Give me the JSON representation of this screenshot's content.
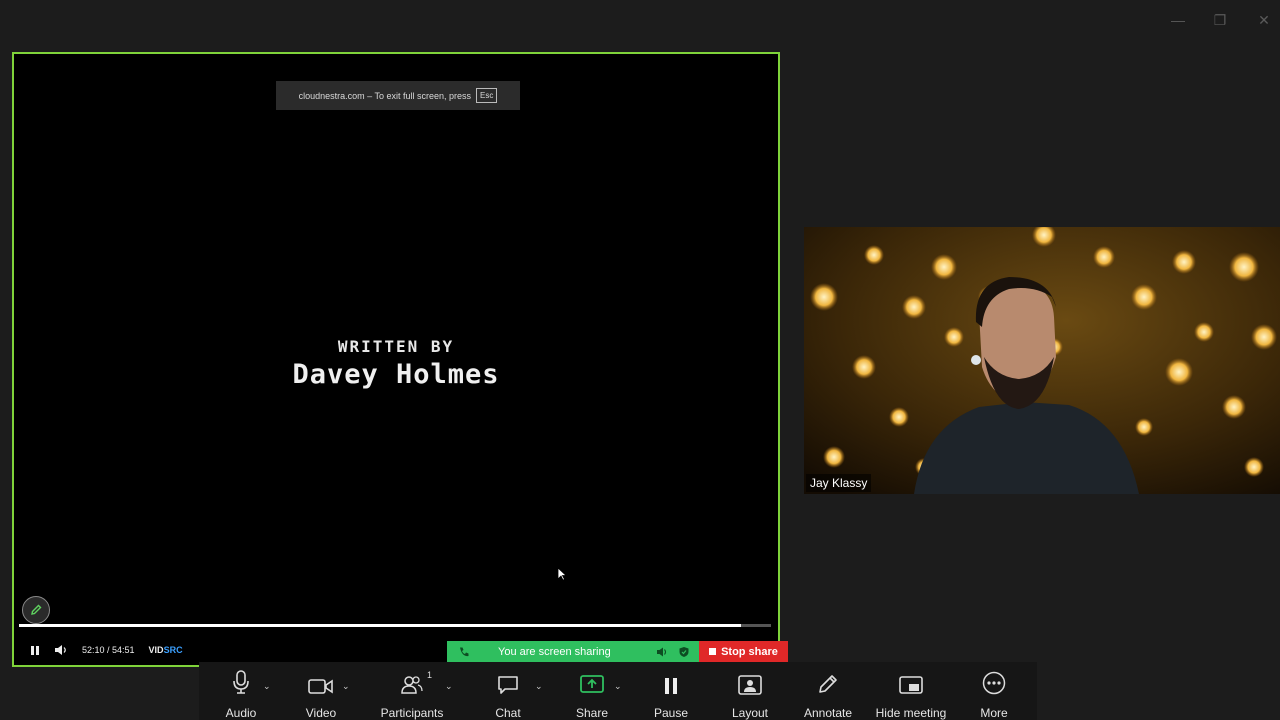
{
  "window": {
    "minimize_glyph": "—",
    "restore_glyph": "❐",
    "close_glyph": "✕"
  },
  "share": {
    "fullscreen_notice": "cloudnestra.com – To exit full screen, press",
    "esc_label": "Esc",
    "credit_title": "WRITTEN BY",
    "credit_name": "Davey Holmes",
    "time": "52:10 / 54:51",
    "brand_a": "VID",
    "brand_b": "SRC",
    "progress": 0.96
  },
  "sharing_bar": {
    "status": "You are screen sharing",
    "stop_label": "Stop share"
  },
  "participant": {
    "name": "Jay Klassy"
  },
  "toolbar": {
    "participants_count": "1",
    "items": [
      {
        "label": "Audio",
        "icon": "microphone-icon"
      },
      {
        "label": "Video",
        "icon": "video-camera-icon"
      },
      {
        "label": "Participants",
        "icon": "participants-icon"
      },
      {
        "label": "Chat",
        "icon": "chat-bubble-icon"
      },
      {
        "label": "Share",
        "icon": "share-screen-icon"
      },
      {
        "label": "Pause",
        "icon": "pause-icon"
      },
      {
        "label": "Layout",
        "icon": "layout-icon"
      },
      {
        "label": "Annotate",
        "icon": "pencil-icon"
      },
      {
        "label": "Hide meeting",
        "icon": "hide-meeting-icon"
      },
      {
        "label": "More",
        "icon": "more-dots-icon"
      }
    ]
  },
  "colors": {
    "share_border": "#7fd33a",
    "sharing_green": "#2fbf5f",
    "stop_red": "#e02828",
    "share_icon": "#2fbf5f"
  }
}
